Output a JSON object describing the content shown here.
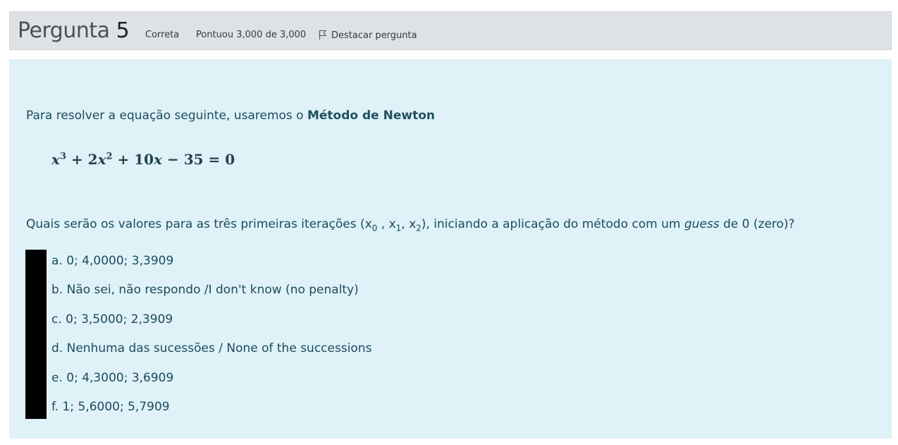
{
  "header": {
    "title_word": "Pergunta",
    "question_number": "5",
    "status": "Correta",
    "score": "Pontuou 3,000 de 3,000",
    "flag_label": "Destacar pergunta"
  },
  "question": {
    "intro_text": "Para resolver a equação seguinte, usaremos o ",
    "intro_bold": "Método de Newton",
    "equation": {
      "var1": "x",
      "exp1": "3",
      "op1": " + ",
      "coef2": "2",
      "var2": "x",
      "exp2": "2",
      "op2": " + ",
      "coef3": "10",
      "var3": "x",
      "op3": " − ",
      "const": "35",
      "eq": " = ",
      "rhs": "0"
    },
    "prompt_start": "Quais serão os valores para as três primeiras iterações (x",
    "sub0": "0",
    "sep1": " , x",
    "sub1": "1",
    "sep2": ", x",
    "sub2": "2",
    "prompt_mid": "), iniciando a aplicação do método com um ",
    "prompt_em": "guess",
    "prompt_end": " de 0 (zero)?"
  },
  "options": [
    "a. 0;  4,0000;  3,3909",
    "b. Não sei, não respondo /I don't know (no penalty)",
    "c. 0;  3,5000;  2,3909",
    "d. Nenhuma das sucessões / None of the successions",
    "e. 0;  4,3000;  3,6909",
    "f. 1;  5,6000;  5,7909"
  ],
  "icons": {
    "flag": "flag-icon"
  }
}
